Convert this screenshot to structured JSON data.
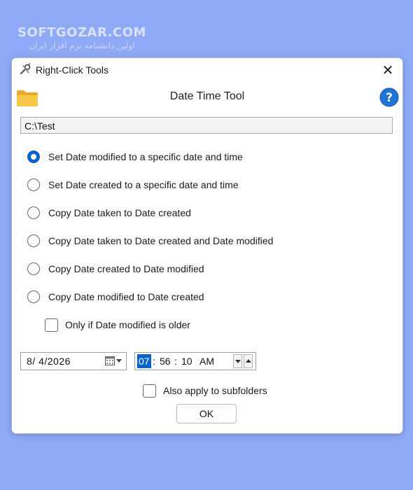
{
  "watermark": {
    "title": "SOFTGOZAR.COM",
    "subtitle": "اولین دانشنامه نرم افزار ایران"
  },
  "window": {
    "title": "Right-Click Tools",
    "close_symbol": "✕"
  },
  "tool": {
    "title": "Date Time Tool"
  },
  "path": {
    "value": "C:\\Test"
  },
  "options": [
    {
      "label": "Set Date modified to a specific date and time",
      "checked": true
    },
    {
      "label": "Set Date created to a specific date and time",
      "checked": false
    },
    {
      "label": "Copy Date taken to Date created",
      "checked": false
    },
    {
      "label": "Copy Date taken to Date created and Date modified",
      "checked": false
    },
    {
      "label": "Copy Date created to Date modified",
      "checked": false
    },
    {
      "label": "Copy Date modified to Date created",
      "checked": false
    }
  ],
  "only_if_older": {
    "label": "Only if Date modified is older",
    "checked": false
  },
  "date": {
    "value": "8/  4/2026"
  },
  "time": {
    "hour": "07",
    "minute": "56",
    "second": "10",
    "ampm": "AM",
    "sep": ":"
  },
  "subfolders": {
    "label": "Also apply to subfolders",
    "checked": false
  },
  "ok_label": "OK",
  "colors": {
    "accent": "#0a63c9",
    "background": "#8ea9f5",
    "folder": "#f5c242",
    "help": "#1e74d6"
  }
}
